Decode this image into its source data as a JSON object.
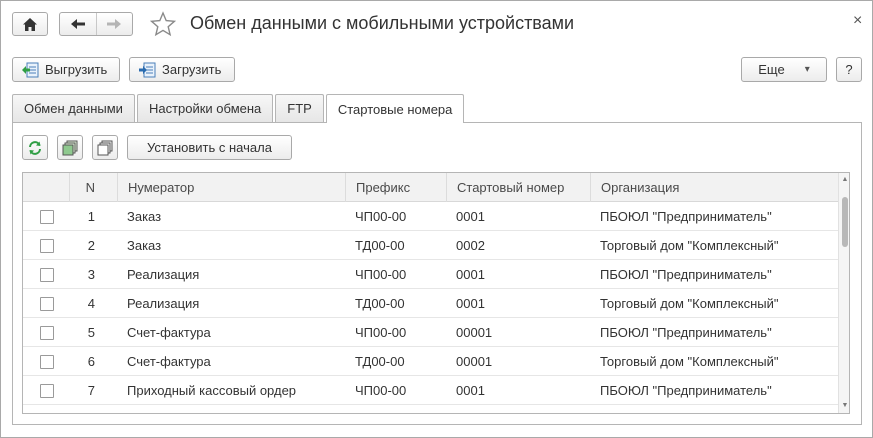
{
  "window": {
    "title": "Обмен данными с мобильными устройствами",
    "close_glyph": "×"
  },
  "toolbar": {
    "export_label": "Выгрузить",
    "import_label": "Загрузить",
    "more_label": "Еще",
    "more_arrow": "▾",
    "help_label": "?"
  },
  "tabs": [
    {
      "label": "Обмен данными"
    },
    {
      "label": "Настройки обмена"
    },
    {
      "label": "FTP"
    },
    {
      "label": "Стартовые номера"
    }
  ],
  "panel": {
    "reset_label": "Установить с начала"
  },
  "table": {
    "headers": {
      "n": "N",
      "numerator": "Нумератор",
      "prefix": "Префикс",
      "start_number": "Стартовый номер",
      "organization": "Организация"
    },
    "rows": [
      {
        "n": "1",
        "numerator": "Заказ",
        "prefix": "ЧП00-00",
        "start_number": "0001",
        "organization": "ПБОЮЛ \"Предприниматель\""
      },
      {
        "n": "2",
        "numerator": "Заказ",
        "prefix": "ТД00-00",
        "start_number": "0002",
        "organization": "Торговый дом \"Комплексный\""
      },
      {
        "n": "3",
        "numerator": "Реализация",
        "prefix": "ЧП00-00",
        "start_number": "0001",
        "organization": "ПБОЮЛ \"Предприниматель\""
      },
      {
        "n": "4",
        "numerator": "Реализация",
        "prefix": "ТД00-00",
        "start_number": "0001",
        "organization": "Торговый дом \"Комплексный\""
      },
      {
        "n": "5",
        "numerator": "Счет-фактура",
        "prefix": "ЧП00-00",
        "start_number": "00001",
        "organization": "ПБОЮЛ \"Предприниматель\""
      },
      {
        "n": "6",
        "numerator": "Счет-фактура",
        "prefix": "ТД00-00",
        "start_number": "00001",
        "organization": "Торговый дом \"Комплексный\""
      },
      {
        "n": "7",
        "numerator": "Приходный кассовый ордер",
        "prefix": "ЧП00-00",
        "start_number": "0001",
        "organization": "ПБОЮЛ \"Предприниматель\""
      }
    ]
  },
  "colors": {
    "accent_green": "#2f9e44",
    "accent_blue": "#2b6cb0",
    "border": "#b5b5b5"
  },
  "icons": {
    "home": "home-icon",
    "back": "arrow-left-icon",
    "forward": "arrow-right-icon",
    "favorite": "star-icon",
    "close": "close-icon",
    "export": "export-icon",
    "import": "import-icon",
    "refresh": "refresh-icon",
    "copy": "copy-icon",
    "paste": "paste-icon"
  }
}
